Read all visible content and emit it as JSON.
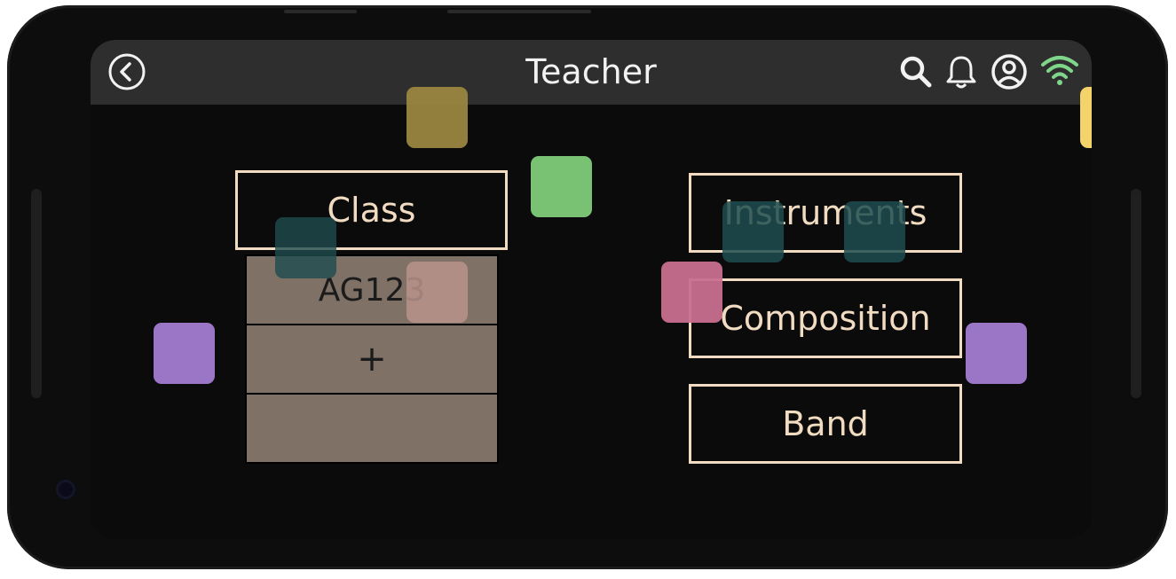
{
  "header": {
    "title": "Teacher",
    "icons": [
      "back-icon",
      "search-icon",
      "bell-icon",
      "account-icon",
      "wifi-icon"
    ]
  },
  "left": {
    "class_label": "Class",
    "rows": [
      "AG123",
      "+",
      ""
    ]
  },
  "right": {
    "buttons": [
      "Instruments",
      "Composition",
      "Band"
    ]
  },
  "colors": {
    "accent_outline": "#f1dcc2",
    "row_fill": "#7f7166",
    "appbar": "#2e2e2e",
    "wifi": "#7fd68a",
    "squares": [
      "#9a8640",
      "#79c274",
      "#1f4c4f",
      "#b9938c",
      "#c96f90",
      "#9b76c7",
      "#f3d36a"
    ]
  }
}
